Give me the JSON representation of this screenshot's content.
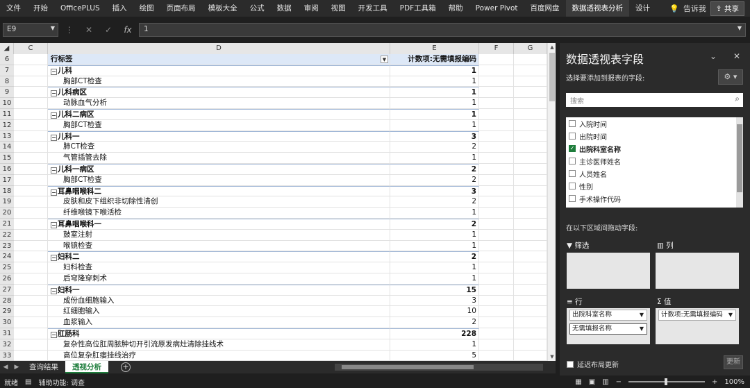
{
  "ribbon": {
    "tabs": [
      "文件",
      "开始",
      "OfficePLUS",
      "插入",
      "绘图",
      "页面布局",
      "模板大全",
      "公式",
      "数据",
      "审阅",
      "视图",
      "开发工具",
      "PDF工具箱",
      "帮助",
      "Power Pivot",
      "百度网盘",
      "数据透视表分析",
      "设计"
    ],
    "active_tab": "数据透视表分析",
    "tell_me": "告诉我",
    "share": "共享"
  },
  "formula_bar": {
    "name_box": "E9",
    "value": "1"
  },
  "columns": [
    "C",
    "D",
    "E",
    "F",
    "G"
  ],
  "pivot": {
    "header_label": "行标签",
    "header_value": "计数项:无需填报编码",
    "rows": [
      {
        "row": "6",
        "type": "header"
      },
      {
        "row": "7",
        "label": "儿科",
        "value": "1",
        "group": true
      },
      {
        "row": "8",
        "label": "胸部CT检查",
        "value": "1",
        "group": false
      },
      {
        "row": "9",
        "label": "儿科病区",
        "value": "1",
        "group": true
      },
      {
        "row": "10",
        "label": "动脉血气分析",
        "value": "1",
        "group": false
      },
      {
        "row": "11",
        "label": "儿科二病区",
        "value": "1",
        "group": true
      },
      {
        "row": "12",
        "label": "胸部CT检查",
        "value": "1",
        "group": false
      },
      {
        "row": "13",
        "label": "儿科一",
        "value": "3",
        "group": true
      },
      {
        "row": "14",
        "label": "肺CT检查",
        "value": "2",
        "group": false
      },
      {
        "row": "15",
        "label": "气管插管去除",
        "value": "1",
        "group": false
      },
      {
        "row": "16",
        "label": "儿科一病区",
        "value": "2",
        "group": true
      },
      {
        "row": "17",
        "label": "胸部CT检查",
        "value": "2",
        "group": false
      },
      {
        "row": "18",
        "label": "耳鼻咽喉科二",
        "value": "3",
        "group": true
      },
      {
        "row": "19",
        "label": "皮肤和皮下组织非切除性清创",
        "value": "2",
        "group": false
      },
      {
        "row": "20",
        "label": "纤维喉镜下喉活检",
        "value": "1",
        "group": false
      },
      {
        "row": "21",
        "label": "耳鼻咽喉科一",
        "value": "2",
        "group": true
      },
      {
        "row": "22",
        "label": "鼓室注射",
        "value": "1",
        "group": false
      },
      {
        "row": "23",
        "label": "喉镜检查",
        "value": "1",
        "group": false
      },
      {
        "row": "24",
        "label": "妇科二",
        "value": "2",
        "group": true
      },
      {
        "row": "25",
        "label": "妇科检查",
        "value": "1",
        "group": false
      },
      {
        "row": "26",
        "label": "后穹隆穿刺术",
        "value": "1",
        "group": false
      },
      {
        "row": "27",
        "label": "妇科一",
        "value": "15",
        "group": true
      },
      {
        "row": "28",
        "label": "成份血细胞输入",
        "value": "3",
        "group": false
      },
      {
        "row": "29",
        "label": "红细胞输入",
        "value": "10",
        "group": false
      },
      {
        "row": "30",
        "label": "血浆输入",
        "value": "2",
        "group": false
      },
      {
        "row": "31",
        "label": "肛肠科",
        "value": "228",
        "group": true
      },
      {
        "row": "32",
        "label": "复杂性高位肛周脓肿切开引流原发病灶清除挂线术",
        "value": "1",
        "group": false
      },
      {
        "row": "33",
        "label": "高位复杂肛瘘挂线治疗",
        "value": "5",
        "group": false
      }
    ]
  },
  "sheet_tabs": [
    "查询结果",
    "透视分析"
  ],
  "active_sheet": "透视分析",
  "status": {
    "mode": "就绪",
    "accessibility": "辅助功能: 调查",
    "zoom": "100%"
  },
  "pane": {
    "title": "数据透视表字段",
    "choose_label": "选择要添加到报表的字段:",
    "search_placeholder": "搜索",
    "fields": [
      {
        "name": "入院时间",
        "checked": false
      },
      {
        "name": "出院时间",
        "checked": false
      },
      {
        "name": "出院科室名称",
        "checked": true
      },
      {
        "name": "主诊医师姓名",
        "checked": false
      },
      {
        "name": "人员姓名",
        "checked": false
      },
      {
        "name": "性别",
        "checked": false
      },
      {
        "name": "手术操作代码",
        "checked": false
      }
    ],
    "drag_hint": "在以下区域间拖动字段:",
    "areas": {
      "filter": "筛选",
      "columns": "列",
      "rows": "行",
      "values": "值"
    },
    "row_fields": [
      "出院科室名称",
      "无需填报名称"
    ],
    "value_fields": [
      "计数项:无需填报编码"
    ],
    "defer_label": "延迟布局更新",
    "update_label": "更新"
  }
}
